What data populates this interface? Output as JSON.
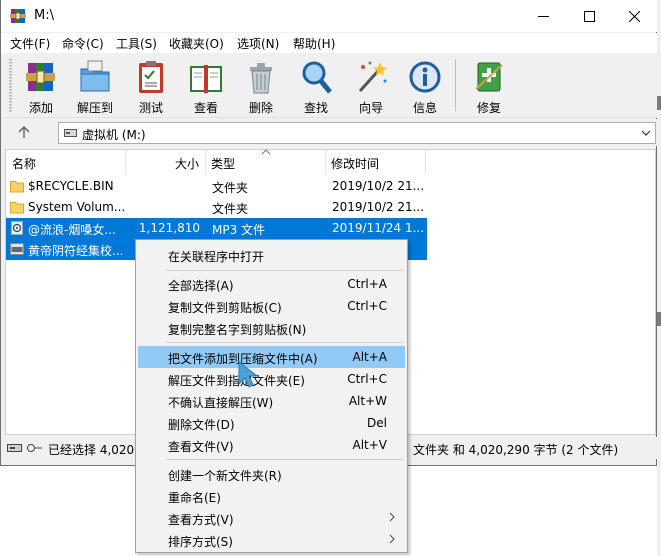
{
  "window": {
    "title": "M:\\"
  },
  "menubar": {
    "items": [
      "文件(F)",
      "命令(C)",
      "工具(S)",
      "收藏夹(O)",
      "选项(N)",
      "帮助(H)"
    ]
  },
  "toolbar": {
    "buttons": [
      "添加",
      "解压到",
      "测试",
      "查看",
      "删除",
      "查找",
      "向导",
      "信息",
      "修复"
    ]
  },
  "address": {
    "path": "虚拟机 (M:)"
  },
  "columns": {
    "name": "名称",
    "size": "大小",
    "type": "类型",
    "modified": "修改时间"
  },
  "files": [
    {
      "name": "$RECYCLE.BIN",
      "size": "",
      "type": "文件夹",
      "modified": "2019/10/2 21...",
      "icon": "folder-icon",
      "selected": false
    },
    {
      "name": "System Volum...",
      "size": "",
      "type": "文件夹",
      "modified": "2019/10/2 21...",
      "icon": "folder-icon",
      "selected": false
    },
    {
      "name": "@流浪-烟嗓女...",
      "size": "1,121,810",
      "type": "MP3 文件",
      "modified": "2019/11/24 1...",
      "icon": "audio-file-icon",
      "selected": true
    },
    {
      "name": "黄帝阴符经集校...",
      "size": "",
      "type": "",
      "modified": "",
      "icon": "pdf-file-icon",
      "selected": true
    }
  ],
  "status": {
    "left": "已经选择 4,020,",
    "right": "文件夹 和 4,020,290 字节 (2 个文件)"
  },
  "context_menu": {
    "groups": [
      [
        {
          "label": "在关联程序中打开",
          "shortcut": ""
        }
      ],
      [
        {
          "label": "全部选择(A)",
          "shortcut": "Ctrl+A"
        },
        {
          "label": "复制文件到剪贴板(C)",
          "shortcut": "Ctrl+C"
        },
        {
          "label": "复制完整名字到剪贴板(N)",
          "shortcut": ""
        }
      ],
      [
        {
          "label": "把文件添加到压缩文件中(A)",
          "shortcut": "Alt+A",
          "highlighted": true
        },
        {
          "label": "解压文件到指定文件夹(E)",
          "shortcut": "Ctrl+C"
        },
        {
          "label": "不确认直接解压(W)",
          "shortcut": "Alt+W"
        },
        {
          "label": "删除文件(D)",
          "shortcut": "Del"
        },
        {
          "label": "查看文件(V)",
          "shortcut": "Alt+V"
        }
      ],
      [
        {
          "label": "创建一个新文件夹(R)",
          "shortcut": ""
        },
        {
          "label": "重命名(E)",
          "shortcut": ""
        },
        {
          "label": "查看方式(V)",
          "shortcut": "",
          "submenu": true
        },
        {
          "label": "排序方式(S)",
          "shortcut": "",
          "submenu": true
        }
      ]
    ]
  },
  "colors": {
    "selection": "#0078d7",
    "menu_highlight": "#91c9f7",
    "cursor": "#4aa3d8"
  }
}
